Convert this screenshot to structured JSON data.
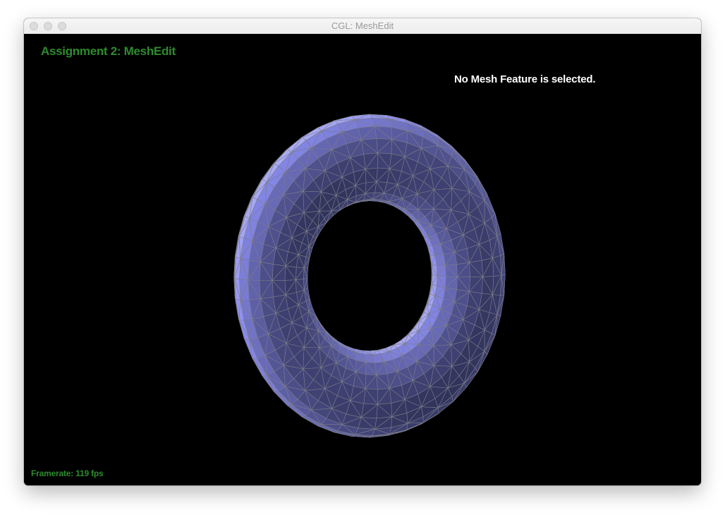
{
  "window": {
    "title": "CGL: MeshEdit",
    "buttons": [
      "close",
      "minimize",
      "zoom"
    ]
  },
  "overlay": {
    "assignment_title": "Assignment 2: MeshEdit",
    "selection_status": "No Mesh Feature is selected.",
    "framerate": "Framerate: 119 fps"
  },
  "mesh": {
    "type": "torus",
    "render_style": "flat-shaded triangles with grey wireframe",
    "base_color": "#8a8cf0",
    "highlight_color": "#f2f2ff",
    "shadow_color": "#30335a",
    "edge_color": "#7c7c88"
  },
  "colors": {
    "background": "#000000",
    "overlay_green": "#2e8b2e",
    "overlay_white": "#ffffff"
  }
}
